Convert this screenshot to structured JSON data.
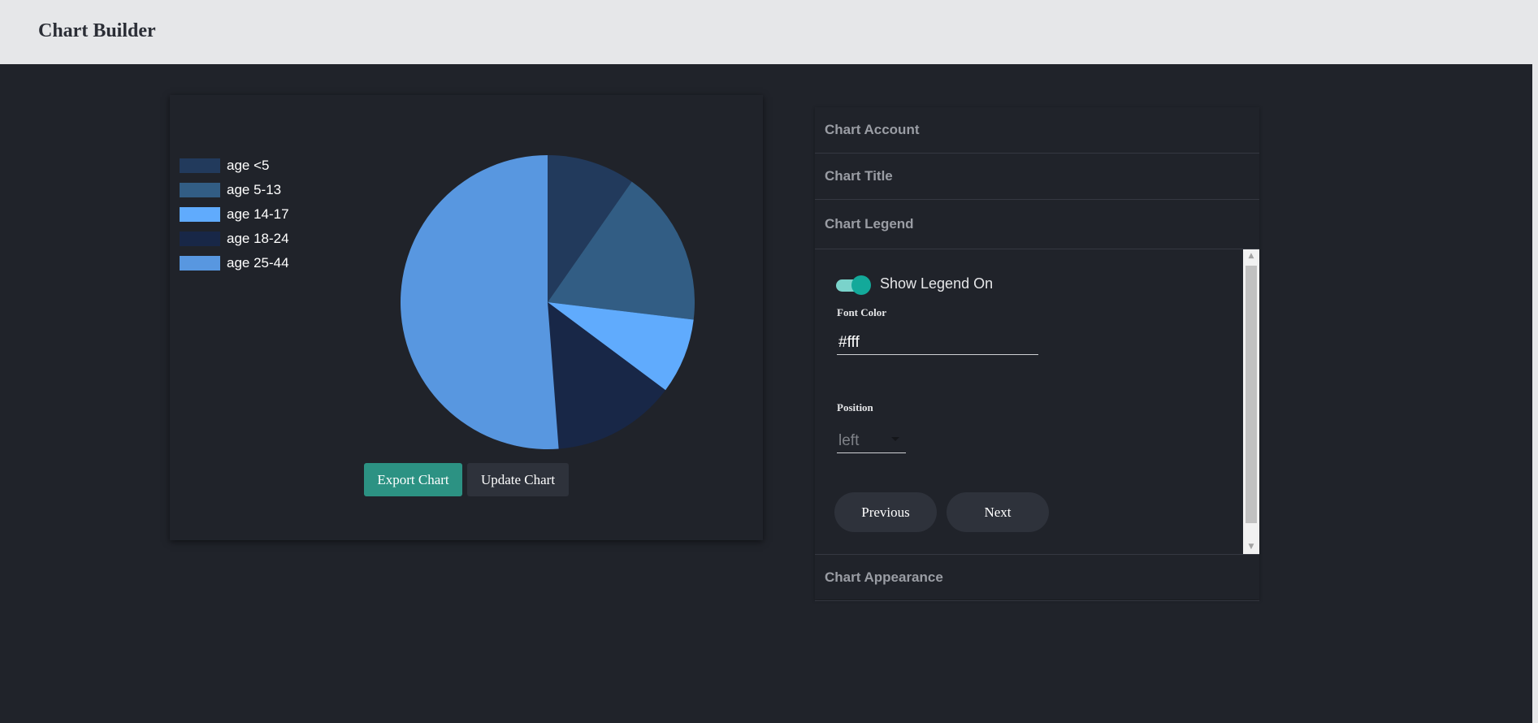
{
  "app": {
    "title": "Chart Builder"
  },
  "colors": {
    "background": "#20232a",
    "topbar": "#e6e7e9",
    "accent": "#2c9283",
    "toggle_on": "#13a99a"
  },
  "chart_data": {
    "type": "pie",
    "categories": [
      "age <5",
      "age 5-13",
      "age 14-17",
      "age 18-24",
      "age 25-44"
    ],
    "values": [
      9.7,
      17.2,
      8.3,
      13.6,
      51.2
    ],
    "colors": [
      "#223a5c",
      "#325d84",
      "#60abfd",
      "#182747",
      "#5897e0"
    ],
    "legend": {
      "visible": true,
      "position": "left",
      "font_color": "#fff"
    }
  },
  "chart_card": {
    "legend_items": [
      "age <5",
      "age 5-13",
      "age 14-17",
      "age 18-24",
      " age 25-44"
    ],
    "export_label": "Export Chart",
    "update_label": "Update Chart"
  },
  "settings": {
    "sections": {
      "account": "Chart Account",
      "title": "Chart Title",
      "legend": "Chart Legend",
      "appearance": "Chart Appearance"
    },
    "legend_panel": {
      "toggle_label": "Show Legend On",
      "toggle_on": true,
      "font_color_label": "Font Color",
      "font_color_value": "#fff",
      "position_label": "Position",
      "position_value": "left",
      "previous_label": "Previous",
      "next_label": "Next"
    }
  },
  "icons": {
    "scroll_up": "triangle-up-icon",
    "scroll_down": "triangle-down-icon",
    "select_caret": "caret-down-icon"
  }
}
